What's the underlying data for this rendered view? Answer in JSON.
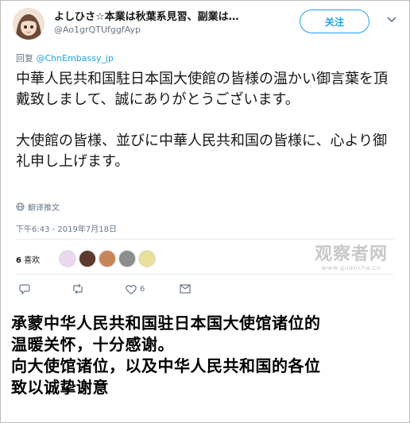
{
  "tweet": {
    "display_name": "よしひさ☆本業は秋葉系見習、副業は…",
    "handle": "@Ao1grQTUfggfAyp",
    "follow_label": "关注",
    "reply_prefix": "回复",
    "reply_mention": "@ChnEmbassy_jp",
    "text_paragraphs": [
      "中華人民共和国駐日本国大使館の皆様の温かい御言葉を頂戴致しまして、誠にありがとうございます。",
      "大使館の皆様、並びに中華人民共和国の皆様に、心より御礼申し上げます。"
    ],
    "translate_label": "翻译推文",
    "timestamp": "下午6:43 - 2019年7月18日",
    "likes_count": "6",
    "likes_label": "喜欢",
    "action_like_count": "6"
  },
  "watermark": {
    "name": "观察者网",
    "url": "www.guancha.cn"
  },
  "caption": {
    "lines": [
      "承蒙中华人民共和国驻日本国大使馆诸位的",
      "温暖关怀，十分感谢。",
      "向大使馆诸位，以及中华人民共和国的各位",
      "致以诚挚谢意"
    ]
  },
  "icons": {
    "reply": "reply-icon",
    "retweet": "retweet-icon",
    "like": "heart-icon",
    "dm": "mail-icon",
    "translate": "globe-icon",
    "caret": "chevron-down-icon"
  },
  "colors": {
    "accent": "#1da1f2",
    "text": "#14171a",
    "muted": "#657786"
  }
}
